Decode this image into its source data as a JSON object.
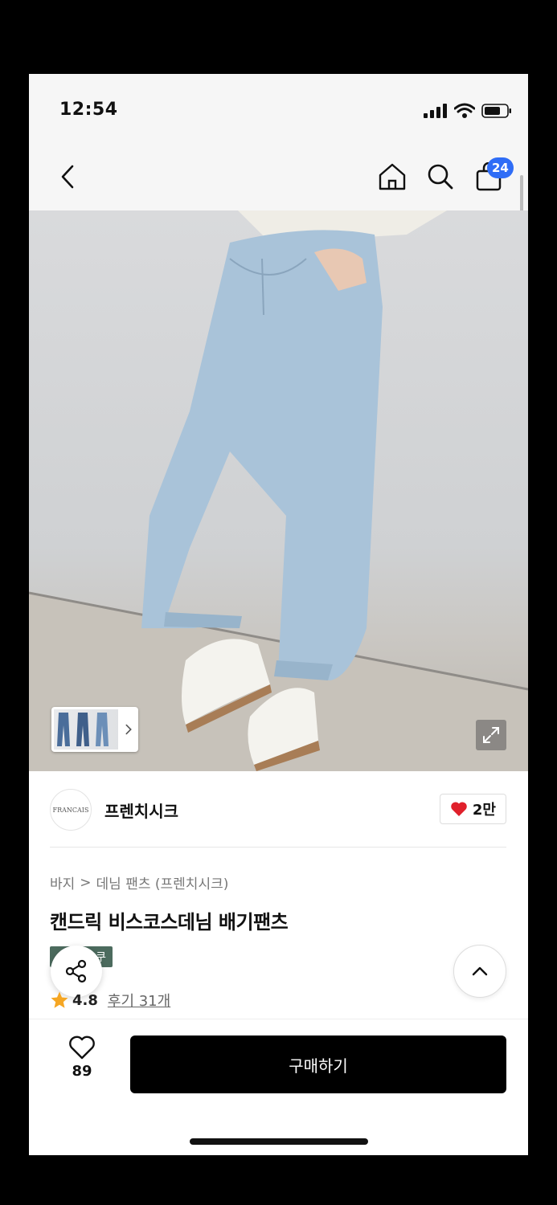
{
  "status_bar": {
    "time": "12:54"
  },
  "nav": {
    "cart_count": "24"
  },
  "shop": {
    "logo_text": "FRANCAIS",
    "name": "프렌치시크",
    "likes": "2만"
  },
  "breadcrumb": {
    "category": "바지",
    "separator": ">",
    "subcategory": "데님 팬츠 (프렌치시크)"
  },
  "product": {
    "title": "캔드릭 비스코스데님 배기팬츠",
    "tag": "쿠",
    "rating": "4.8",
    "reviews": "후기 31개"
  },
  "bottom": {
    "wish_count": "89",
    "buy_label": "구매하기"
  },
  "colors": {
    "accent": "#2f6df6",
    "buy": "#000000",
    "heart": "#e0202b",
    "star": "#f5a623"
  },
  "icons": [
    "back-icon",
    "home-icon",
    "search-icon",
    "bag-icon",
    "expand-icon",
    "chevron-right-icon",
    "share-icon",
    "chevron-up-icon",
    "heart-icon",
    "star-icon"
  ]
}
